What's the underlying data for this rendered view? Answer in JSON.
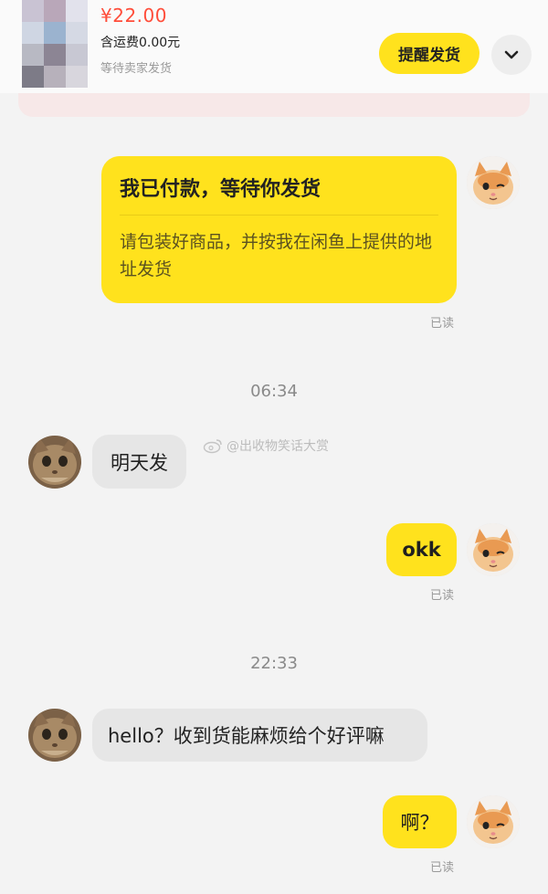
{
  "order": {
    "price": "¥22.00",
    "shipping": "含运费0.00元",
    "status": "等待卖家发货",
    "remind_button": "提醒发货"
  },
  "icons": {
    "expand": "chevron-down-icon",
    "watermark": "weibo-icon"
  },
  "messages": {
    "card": {
      "title": "我已付款，等待你发货",
      "body": "请包装好商品，并按我在闲鱼上提供的地址发货",
      "read": "已读"
    },
    "time1": "06:34",
    "msg1": "明天发",
    "watermark": "@出收物笑话大赏",
    "msg2": "okk",
    "msg2_read": "已读",
    "time2": "22:33",
    "msg3": "hello？收到货能麻烦给个好评嘛",
    "msg4": "啊？",
    "msg4_read": "已读"
  },
  "colors": {
    "accent_yellow": "#ffe21d",
    "price_red": "#ff4d3a",
    "background": "#f3f3f3"
  }
}
